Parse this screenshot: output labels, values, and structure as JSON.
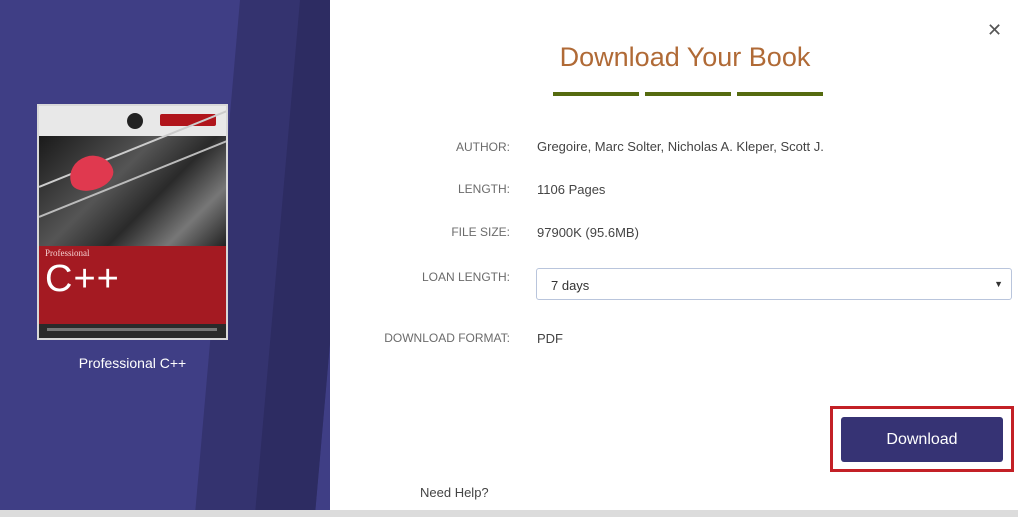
{
  "book": {
    "title": "Professional C++",
    "cover": {
      "series_text": "Professional",
      "main_text": "C++"
    }
  },
  "dialog": {
    "heading": "Download Your Book",
    "close_icon": "close-icon",
    "accent_color": "#556b0f",
    "heading_color": "#b06a36",
    "panel_color": "#3f3e85"
  },
  "details": {
    "author_label": "AUTHOR:",
    "author_value": "Gregoire, Marc Solter, Nicholas A. Kleper, Scott J.",
    "length_label": "LENGTH:",
    "length_value": "1106 Pages",
    "filesize_label": "FILE SIZE:",
    "filesize_value": "97900K (95.6MB)",
    "loan_label": "LOAN LENGTH:",
    "loan_value": "7 days",
    "format_label": "DOWNLOAD FORMAT:",
    "format_value": "PDF"
  },
  "actions": {
    "download_label": "Download",
    "download_color": "#363374",
    "highlight_color": "#c32026",
    "help_label": "Need Help?"
  }
}
